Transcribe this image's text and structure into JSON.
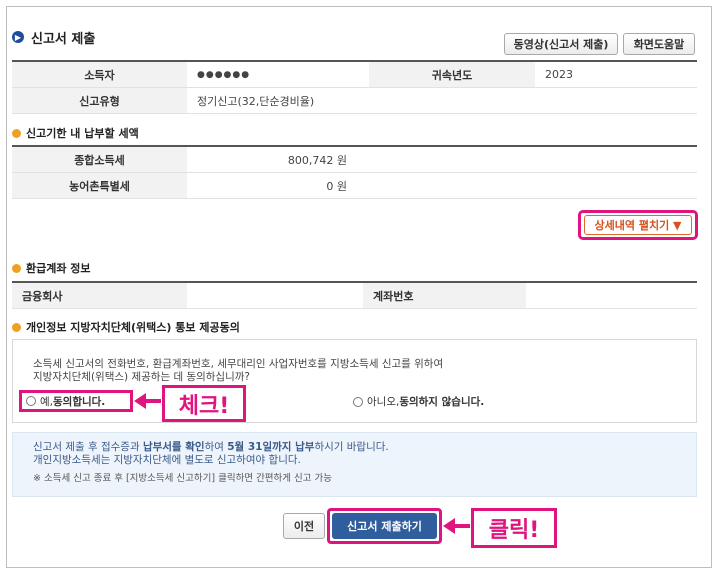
{
  "header": {
    "title": "신고서 제출",
    "video_button": "동영상(신고서 제출)",
    "help_button": "화면도움말"
  },
  "taxpayer": {
    "name_label": "소득자",
    "name_value": "●●●●●●",
    "year_label": "귀속년도",
    "year_value": "2023",
    "type_label": "신고유형",
    "type_value": "정기신고(32,단순경비율)"
  },
  "due": {
    "section_title": "신고기한 내 납부할 세액",
    "rows": [
      {
        "label": "종합소득세",
        "value": "800,742 원"
      },
      {
        "label": "농어촌특별세",
        "value": "0 원"
      }
    ],
    "detail_button": "상세내역 펼치기 ▼"
  },
  "refund": {
    "section_title": "환급계좌 정보",
    "bank_label": "금융회사",
    "bank_value": "",
    "account_label": "계좌번호",
    "account_value": ""
  },
  "consent": {
    "section_title": "개인정보 지방자치단체(위택스) 통보 제공동의",
    "text_line1": "소득세 신고서의 전화번호, 환급계좌번호, 세무대리인 사업자번호를 지방소득세 신고를 위하여",
    "text_line2": "지방자치단체(위택스) 제공하는 데 동의하십니까?",
    "agree_prefix": "예, ",
    "agree_bold": "동의합니다.",
    "disagree_prefix": "아니오, ",
    "disagree_bold": "동의하지 않습니다."
  },
  "notice": {
    "line1_a": "신고서 제출 후 접수증과 ",
    "line1_b": "납부서를 확인",
    "line1_c": "하여 ",
    "line1_d": "5월 31일까지 납부",
    "line1_e": "하시기 바랍니다.",
    "line2": "개인지방소득세는 지방자치단체에 별도로 신고하여야 합니다.",
    "line3": "※ 소득세 신고 종료 후 [지방소득세 신고하기] 클릭하면 간편하게 신고 가능"
  },
  "actions": {
    "prev_button": "이전",
    "submit_button": "신고서 제출하기"
  },
  "callouts": {
    "check": "체크!",
    "click": "클릭!"
  },
  "colors": {
    "accent": "#1f4e99",
    "highlight": "#e0147e",
    "orange": "#d9501b"
  }
}
